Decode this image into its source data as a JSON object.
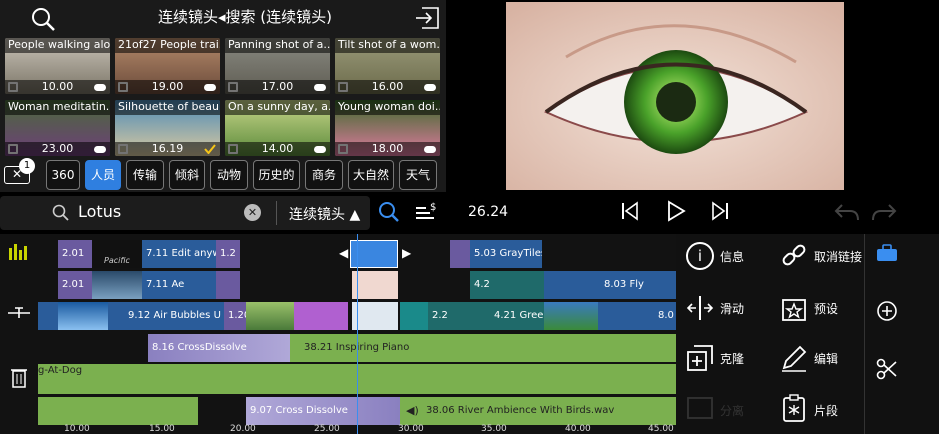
{
  "browser": {
    "title": "连续镜头◂搜索 (连续镜头)",
    "clips": [
      {
        "caption": "People walking alo...",
        "duration": "10.00"
      },
      {
        "caption": "21of27 People trai...",
        "duration": "19.00"
      },
      {
        "caption": "Panning shot of a...",
        "duration": "17.00"
      },
      {
        "caption": "Tilt shot of a wom...",
        "duration": "16.00"
      },
      {
        "caption": "Woman meditatin...",
        "duration": "23.00"
      },
      {
        "caption": "Silhouette of beau...",
        "duration": "16.19"
      },
      {
        "caption": "On a sunny day, a...",
        "duration": "14.00"
      },
      {
        "caption": "Young woman doi...",
        "duration": "18.00"
      }
    ],
    "filter_badge": "1",
    "categories": [
      "360",
      "人员",
      "传输",
      "倾斜",
      "动物",
      "历史的",
      "商务",
      "大自然",
      "天气"
    ]
  },
  "search": {
    "query": "Lotus",
    "scope": "连续镜头 ▲"
  },
  "transport": {
    "timecode": "26.24"
  },
  "timeline": {
    "clips": [
      {
        "label": "2.01"
      },
      {
        "label": "7.11  Edit anyw"
      },
      {
        "label": "1.2"
      },
      {
        "label": "5.03  GrayTiles"
      },
      {
        "label": "2.01"
      },
      {
        "label": "7.11  Ae"
      },
      {
        "label": "4.2"
      },
      {
        "label": "8.03  Fly"
      },
      {
        "label": "9.12  Air Bubbles U"
      },
      {
        "label": "1.20"
      },
      {
        "label": "2.2"
      },
      {
        "label": "4.21  Gree"
      },
      {
        "label": "8.0"
      },
      {
        "label": "8.16   CrossDissolve"
      },
      {
        "label": "38.21  Inspiring Piano"
      },
      {
        "label": "g-At-Dog"
      },
      {
        "label": "9.07  Cross Dissolve"
      },
      {
        "label": "38.06  River Ambience With Birds.wav"
      }
    ],
    "ruler": [
      "10.00",
      "15.00",
      "20.00",
      "25.00",
      "30.00",
      "35.00",
      "40.00",
      "45.00"
    ],
    "thumb_label": "Pacific"
  },
  "panel": {
    "info": "信息",
    "unlink": "取消链接",
    "slide": "滑动",
    "preset": "预设",
    "clone": "克隆",
    "edit": "编辑",
    "split": "分离",
    "clip": "片段"
  }
}
